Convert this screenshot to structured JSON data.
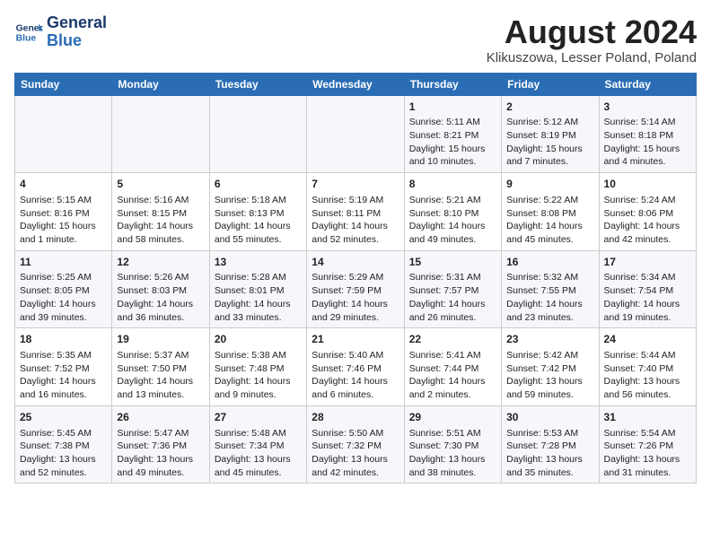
{
  "header": {
    "logo_line1": "General",
    "logo_line2": "Blue",
    "title": "August 2024",
    "subtitle": "Klikuszowa, Lesser Poland, Poland"
  },
  "days_of_week": [
    "Sunday",
    "Monday",
    "Tuesday",
    "Wednesday",
    "Thursday",
    "Friday",
    "Saturday"
  ],
  "weeks": [
    [
      {
        "day": "",
        "content": ""
      },
      {
        "day": "",
        "content": ""
      },
      {
        "day": "",
        "content": ""
      },
      {
        "day": "",
        "content": ""
      },
      {
        "day": "1",
        "content": "Sunrise: 5:11 AM\nSunset: 8:21 PM\nDaylight: 15 hours\nand 10 minutes."
      },
      {
        "day": "2",
        "content": "Sunrise: 5:12 AM\nSunset: 8:19 PM\nDaylight: 15 hours\nand 7 minutes."
      },
      {
        "day": "3",
        "content": "Sunrise: 5:14 AM\nSunset: 8:18 PM\nDaylight: 15 hours\nand 4 minutes."
      }
    ],
    [
      {
        "day": "4",
        "content": "Sunrise: 5:15 AM\nSunset: 8:16 PM\nDaylight: 15 hours\nand 1 minute."
      },
      {
        "day": "5",
        "content": "Sunrise: 5:16 AM\nSunset: 8:15 PM\nDaylight: 14 hours\nand 58 minutes."
      },
      {
        "day": "6",
        "content": "Sunrise: 5:18 AM\nSunset: 8:13 PM\nDaylight: 14 hours\nand 55 minutes."
      },
      {
        "day": "7",
        "content": "Sunrise: 5:19 AM\nSunset: 8:11 PM\nDaylight: 14 hours\nand 52 minutes."
      },
      {
        "day": "8",
        "content": "Sunrise: 5:21 AM\nSunset: 8:10 PM\nDaylight: 14 hours\nand 49 minutes."
      },
      {
        "day": "9",
        "content": "Sunrise: 5:22 AM\nSunset: 8:08 PM\nDaylight: 14 hours\nand 45 minutes."
      },
      {
        "day": "10",
        "content": "Sunrise: 5:24 AM\nSunset: 8:06 PM\nDaylight: 14 hours\nand 42 minutes."
      }
    ],
    [
      {
        "day": "11",
        "content": "Sunrise: 5:25 AM\nSunset: 8:05 PM\nDaylight: 14 hours\nand 39 minutes."
      },
      {
        "day": "12",
        "content": "Sunrise: 5:26 AM\nSunset: 8:03 PM\nDaylight: 14 hours\nand 36 minutes."
      },
      {
        "day": "13",
        "content": "Sunrise: 5:28 AM\nSunset: 8:01 PM\nDaylight: 14 hours\nand 33 minutes."
      },
      {
        "day": "14",
        "content": "Sunrise: 5:29 AM\nSunset: 7:59 PM\nDaylight: 14 hours\nand 29 minutes."
      },
      {
        "day": "15",
        "content": "Sunrise: 5:31 AM\nSunset: 7:57 PM\nDaylight: 14 hours\nand 26 minutes."
      },
      {
        "day": "16",
        "content": "Sunrise: 5:32 AM\nSunset: 7:55 PM\nDaylight: 14 hours\nand 23 minutes."
      },
      {
        "day": "17",
        "content": "Sunrise: 5:34 AM\nSunset: 7:54 PM\nDaylight: 14 hours\nand 19 minutes."
      }
    ],
    [
      {
        "day": "18",
        "content": "Sunrise: 5:35 AM\nSunset: 7:52 PM\nDaylight: 14 hours\nand 16 minutes."
      },
      {
        "day": "19",
        "content": "Sunrise: 5:37 AM\nSunset: 7:50 PM\nDaylight: 14 hours\nand 13 minutes."
      },
      {
        "day": "20",
        "content": "Sunrise: 5:38 AM\nSunset: 7:48 PM\nDaylight: 14 hours\nand 9 minutes."
      },
      {
        "day": "21",
        "content": "Sunrise: 5:40 AM\nSunset: 7:46 PM\nDaylight: 14 hours\nand 6 minutes."
      },
      {
        "day": "22",
        "content": "Sunrise: 5:41 AM\nSunset: 7:44 PM\nDaylight: 14 hours\nand 2 minutes."
      },
      {
        "day": "23",
        "content": "Sunrise: 5:42 AM\nSunset: 7:42 PM\nDaylight: 13 hours\nand 59 minutes."
      },
      {
        "day": "24",
        "content": "Sunrise: 5:44 AM\nSunset: 7:40 PM\nDaylight: 13 hours\nand 56 minutes."
      }
    ],
    [
      {
        "day": "25",
        "content": "Sunrise: 5:45 AM\nSunset: 7:38 PM\nDaylight: 13 hours\nand 52 minutes."
      },
      {
        "day": "26",
        "content": "Sunrise: 5:47 AM\nSunset: 7:36 PM\nDaylight: 13 hours\nand 49 minutes."
      },
      {
        "day": "27",
        "content": "Sunrise: 5:48 AM\nSunset: 7:34 PM\nDaylight: 13 hours\nand 45 minutes."
      },
      {
        "day": "28",
        "content": "Sunrise: 5:50 AM\nSunset: 7:32 PM\nDaylight: 13 hours\nand 42 minutes."
      },
      {
        "day": "29",
        "content": "Sunrise: 5:51 AM\nSunset: 7:30 PM\nDaylight: 13 hours\nand 38 minutes."
      },
      {
        "day": "30",
        "content": "Sunrise: 5:53 AM\nSunset: 7:28 PM\nDaylight: 13 hours\nand 35 minutes."
      },
      {
        "day": "31",
        "content": "Sunrise: 5:54 AM\nSunset: 7:26 PM\nDaylight: 13 hours\nand 31 minutes."
      }
    ]
  ]
}
